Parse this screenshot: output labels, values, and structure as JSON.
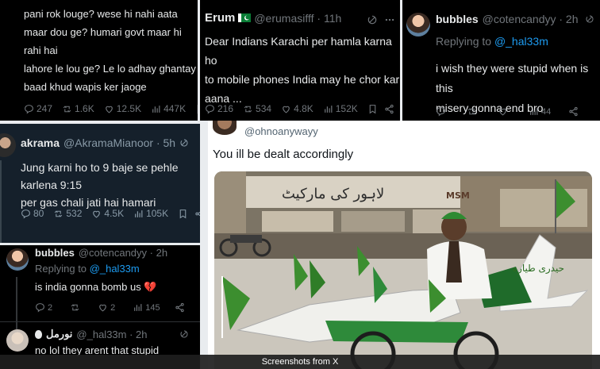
{
  "panel1": {
    "text": [
      "pani rok louge? wese hi nahi aata",
      "maar dou ge? humari govt maar hi rahi hai",
      "lahore le lou ge? Le lo adhay ghantay",
      "baad khud wapis ker jaoge"
    ],
    "stats": {
      "replies": "247",
      "reposts": "1.6K",
      "likes": "12.5K",
      "views": "447K"
    }
  },
  "panel2": {
    "name": "Erum",
    "flag": "PK",
    "handle": "@erumasifff · 11h",
    "text": [
      "Dear Indians Karachi per hamla karna ho",
      "to mobile phones India may he chor kar",
      "aana ..."
    ],
    "stats": {
      "replies": "216",
      "reposts": "534",
      "likes": "4.8K",
      "views": "152K"
    }
  },
  "panel3": {
    "name": "bubbles",
    "handle": "@cotencandyy · 2h",
    "replying_prefix": "Replying to",
    "replying_handle": "@_hal33m",
    "text": [
      "i wish they were stupid when is this",
      "misery gonna end bro"
    ],
    "stats": {
      "views": "44"
    }
  },
  "panel4": {
    "name": "akrama",
    "handle": "@AkramaMianoor · 5h",
    "text": [
      "Jung karni ho to 9 baje se pehle karlena 9:15",
      "per gas chali jati hai hamari"
    ],
    "stats": {
      "replies": "80",
      "reposts": "532",
      "likes": "4.5K",
      "views": "105K"
    }
  },
  "panel5": {
    "tweet1": {
      "name": "bubbles",
      "handle": "@cotencandyy · 2h",
      "replying_prefix": "Replying to",
      "replying_handle": "@_hal33m",
      "text": "is india gonna bomb us",
      "emoji": "💔",
      "stats": {
        "replies": "2",
        "likes": "2",
        "views": "145"
      }
    },
    "tweet2": {
      "name": "نورمل",
      "handle": "@_hal33m · 2h",
      "text": "no lol they arent that stupid"
    }
  },
  "panel6": {
    "handle": "@ohnoanywayy",
    "text": "You ill be dealt accordingly",
    "sign1": "لاہور کی مارکیٹ",
    "sign2": "MSM",
    "plane_text": "حیدری طیارہ"
  },
  "caption": "Screenshots from X",
  "colors": {
    "background": "#000000",
    "text": "#e7e9ea",
    "muted": "#71767b",
    "link": "#1d9bf0",
    "flag_green": "#0a7d36"
  }
}
